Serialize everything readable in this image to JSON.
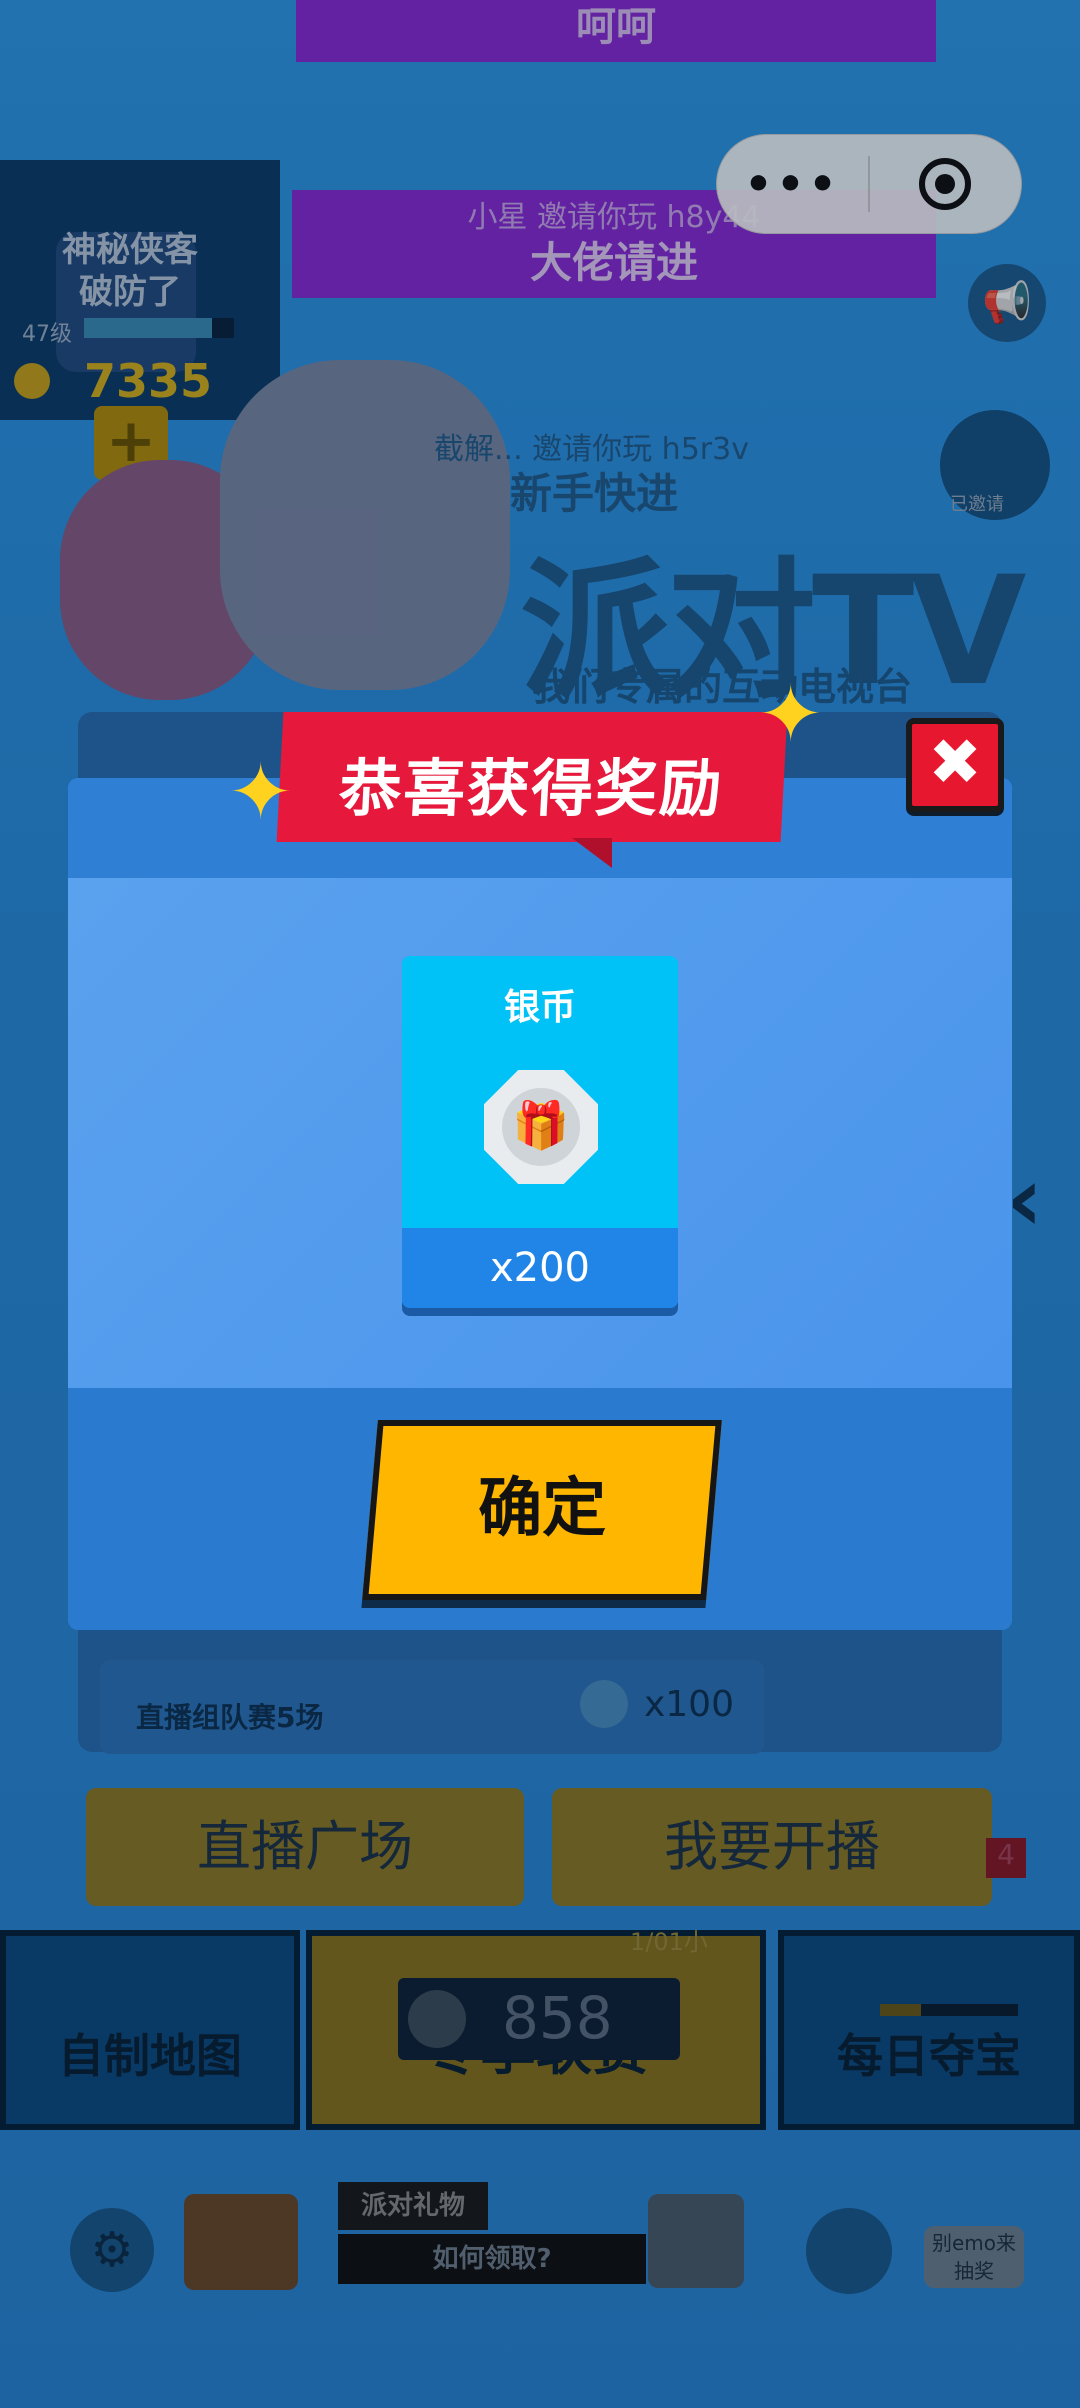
{
  "background": {
    "messages": [
      {
        "line1": "",
        "line2": "呵呵"
      },
      {
        "line1": "小星 邀请你玩 h8y44",
        "line2": "大佬请进"
      }
    ],
    "capsule": {
      "more": "•••",
      "close": "◎"
    },
    "profile": {
      "name": "神秘侠客",
      "status": "破防了",
      "level": "47级",
      "coins": "7335",
      "plus": "+"
    },
    "banner": {
      "scroll_text": "截解... 邀请你玩 h5r3v",
      "subtitle": "新手快进",
      "title": "派对TV",
      "tagline": "我们专属的互动电视台",
      "invited_badge": "已邀请"
    },
    "task": {
      "label": "直播组队赛5场",
      "reward": "x100"
    },
    "buttons": {
      "live_square": "直播广场",
      "start_live": "我要开播"
    },
    "badge": "4",
    "tiles": {
      "left": "自制地图",
      "middle": "冬季联赛",
      "right": "每日夺宝",
      "middle_sub": "1/01小"
    },
    "silver_count": "858",
    "dock": {
      "gift_title": "派对礼物",
      "gift_sub": "如何领取?",
      "lottery": "别emo来抽奖"
    }
  },
  "modal": {
    "title": "恭喜获得奖励",
    "close": "✖",
    "reward": {
      "name": "银币",
      "quantity": "x200"
    },
    "confirm": "确定"
  }
}
